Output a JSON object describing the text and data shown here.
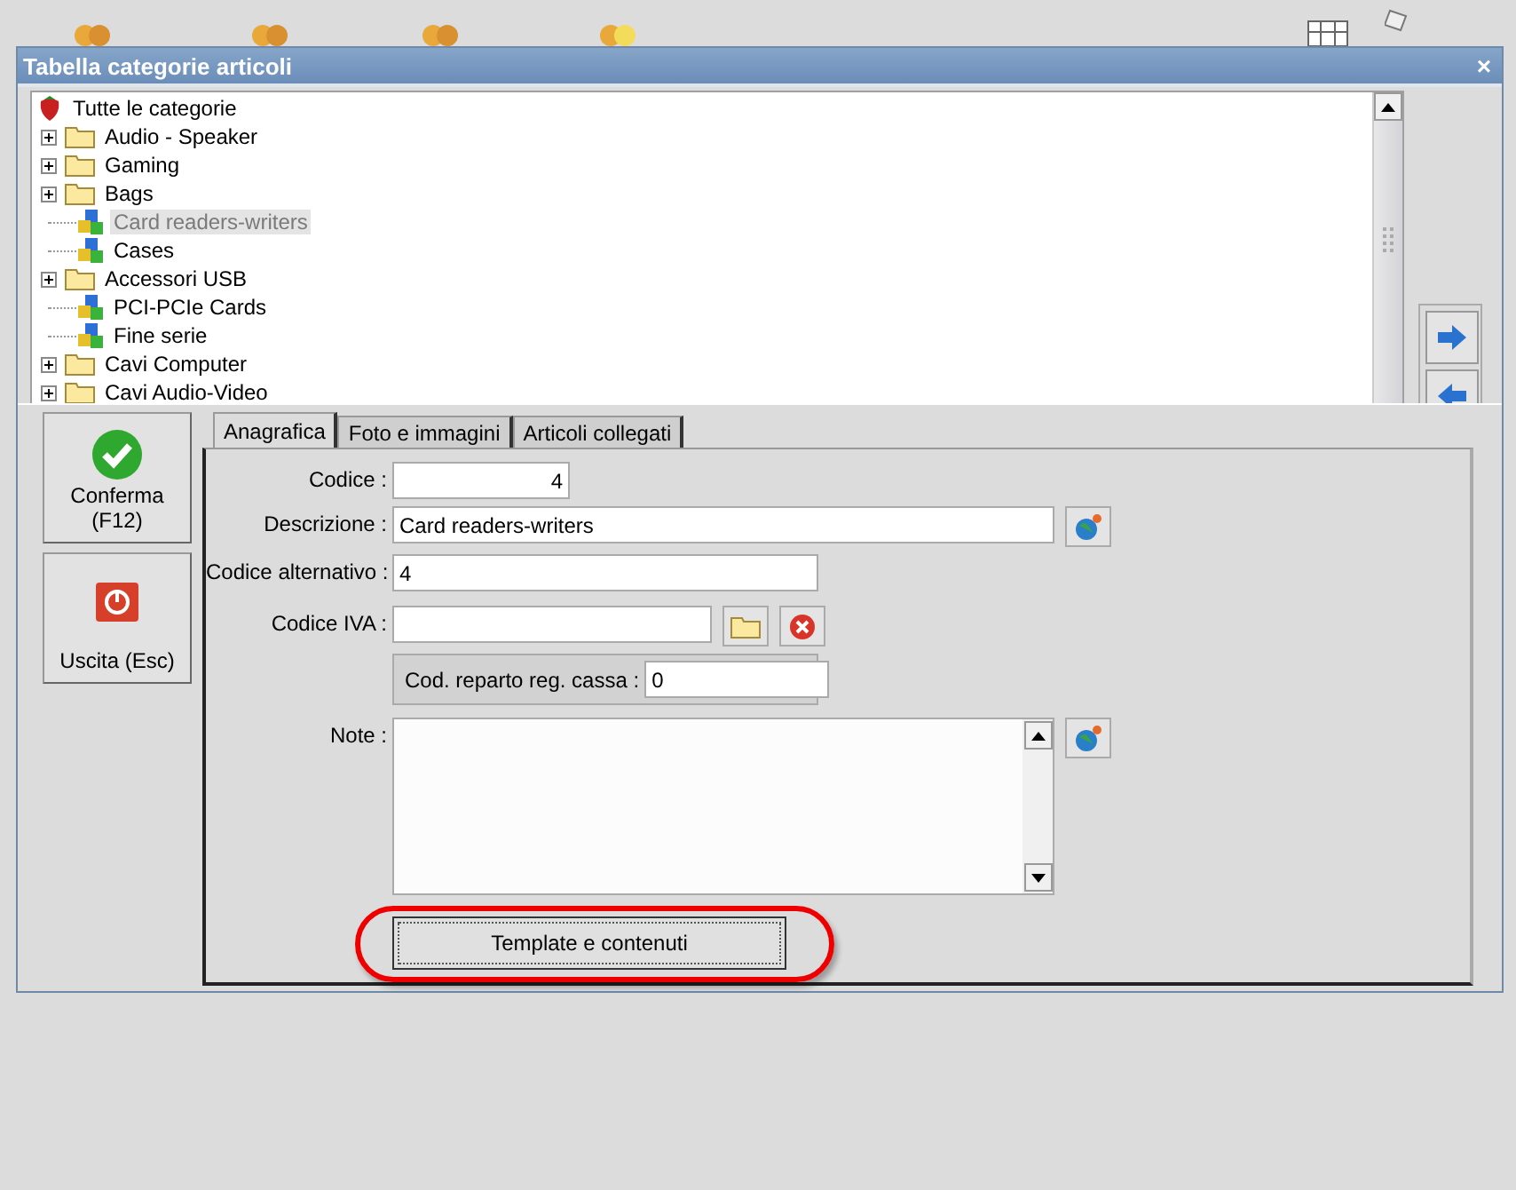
{
  "window": {
    "title": "Tabella categorie articoli",
    "close": "×"
  },
  "tree": {
    "root": {
      "label": "Tutte le categorie",
      "children": [
        {
          "label": "Audio - Speaker",
          "kind": "folder",
          "expanded": false,
          "selected": false
        },
        {
          "label": "Gaming",
          "kind": "folder",
          "expanded": false,
          "selected": false
        },
        {
          "label": "Bags",
          "kind": "folder",
          "expanded": false,
          "selected": false
        },
        {
          "label": "Card readers-writers",
          "kind": "group",
          "selected": true
        },
        {
          "label": "Cases",
          "kind": "group",
          "selected": false
        },
        {
          "label": "Accessori USB",
          "kind": "folder",
          "expanded": false,
          "selected": false
        },
        {
          "label": "PCI-PCIe Cards",
          "kind": "group",
          "selected": false
        },
        {
          "label": "Fine serie",
          "kind": "group",
          "selected": false
        },
        {
          "label": "Cavi Computer",
          "kind": "folder",
          "expanded": false,
          "selected": false
        },
        {
          "label": "Cavi Audio-Video",
          "kind": "folder",
          "expanded": false,
          "selected": false
        }
      ]
    }
  },
  "side_buttons": [
    {
      "label": "Conferma",
      "sub": "(F12)",
      "kind": "confirm"
    },
    {
      "label": "Uscita (Esc)",
      "kind": "exit"
    }
  ],
  "tabs": [
    {
      "label": "Anagrafica",
      "selected": true
    },
    {
      "label": "Foto e immagini",
      "selected": false
    },
    {
      "label": "Articoli collegati",
      "selected": false
    }
  ],
  "form": {
    "codice": {
      "label": "Codice :",
      "value": "4"
    },
    "descrizione": {
      "label": "Descrizione :",
      "value": "Card readers-writers"
    },
    "codice_alternativo": {
      "label": "Codice alternativo :",
      "value": "4"
    },
    "codice_iva": {
      "label": "Codice IVA :"
    },
    "cod_reparto": {
      "label": "Cod. reparto reg. cassa :",
      "value": "0"
    },
    "note": {
      "label": "Note :"
    }
  },
  "template_button": {
    "label": "Template e contenuti",
    "highlighted": true
  }
}
